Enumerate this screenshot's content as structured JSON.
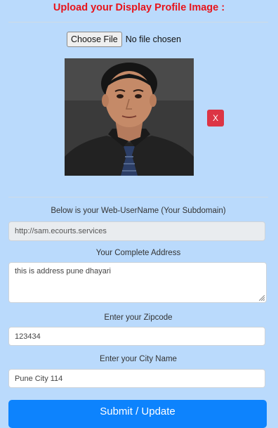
{
  "header": {
    "title": "Upload your Display Profile Image :"
  },
  "upload": {
    "choose_label": "Choose File",
    "status": "No file chosen",
    "remove_label": "X"
  },
  "form": {
    "username_label": "Below is your Web-UserName (Your Subdomain)",
    "username_value": "http://sam.ecourts.services",
    "address_label": "Your Complete Address",
    "address_value": "this is address pune dhayari",
    "zip_label": "Enter your Zipcode",
    "zip_value": "123434",
    "city_label": "Enter your City Name",
    "city_value": "Pune City 114",
    "submit_label": "Submit / Update"
  },
  "colors": {
    "background": "#badafc",
    "title": "#e8141b",
    "danger": "#dc3545",
    "primary": "#0d83fd"
  }
}
